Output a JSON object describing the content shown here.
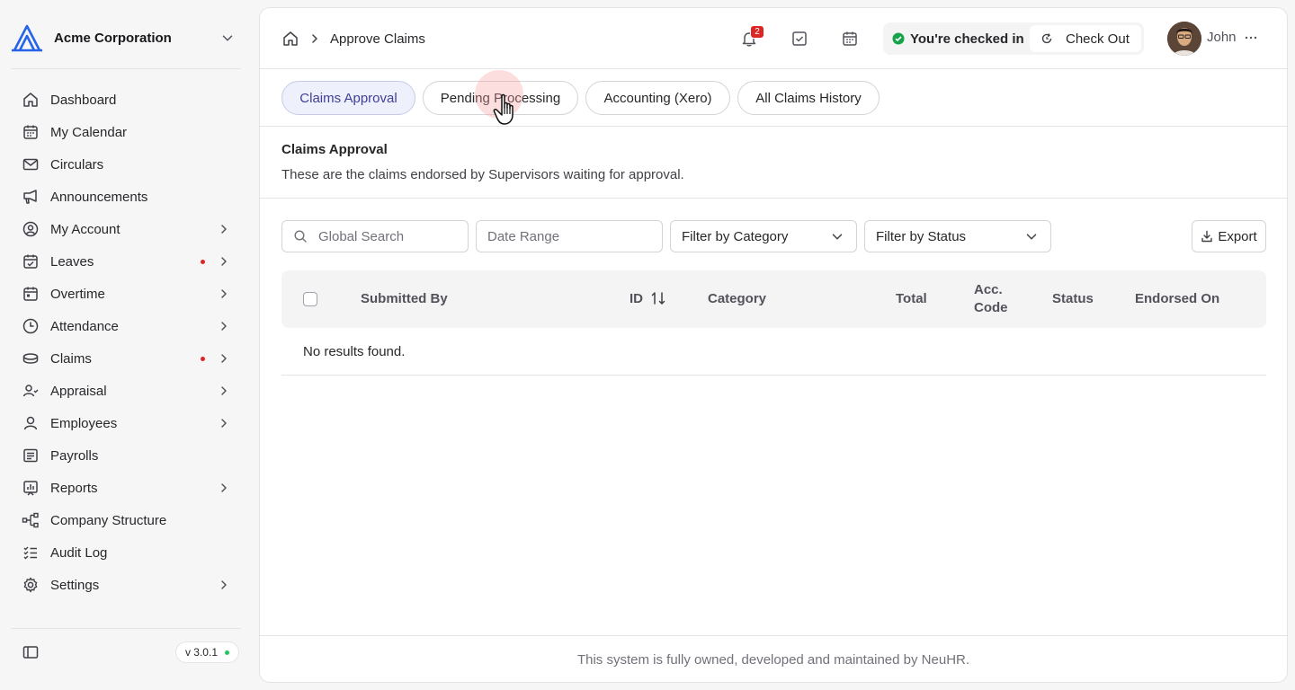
{
  "org": {
    "name": "Acme Corporation"
  },
  "sidebar": {
    "items": [
      {
        "label": "Dashboard",
        "icon": "home-icon",
        "arrow": false,
        "dot": false
      },
      {
        "label": "My Calendar",
        "icon": "calendar-icon",
        "arrow": false,
        "dot": false
      },
      {
        "label": "Circulars",
        "icon": "mail-icon",
        "arrow": false,
        "dot": false
      },
      {
        "label": "Announcements",
        "icon": "megaphone-icon",
        "arrow": false,
        "dot": false
      },
      {
        "label": "My Account",
        "icon": "user-circle-icon",
        "arrow": true,
        "dot": false
      },
      {
        "label": "Leaves",
        "icon": "calendar-check-icon",
        "arrow": true,
        "dot": true
      },
      {
        "label": "Overtime",
        "icon": "calendar-grid-icon",
        "arrow": true,
        "dot": false
      },
      {
        "label": "Attendance",
        "icon": "clock-icon",
        "arrow": true,
        "dot": false
      },
      {
        "label": "Claims",
        "icon": "coins-icon",
        "arrow": true,
        "dot": true
      },
      {
        "label": "Appraisal",
        "icon": "user-check-icon",
        "arrow": true,
        "dot": false
      },
      {
        "label": "Employees",
        "icon": "user-icon",
        "arrow": true,
        "dot": false
      },
      {
        "label": "Payrolls",
        "icon": "receipt-icon",
        "arrow": false,
        "dot": false
      },
      {
        "label": "Reports",
        "icon": "chart-icon",
        "arrow": true,
        "dot": false
      },
      {
        "label": "Company Structure",
        "icon": "hierarchy-icon",
        "arrow": false,
        "dot": false
      },
      {
        "label": "Audit Log",
        "icon": "checklist-icon",
        "arrow": false,
        "dot": false
      },
      {
        "label": "Settings",
        "icon": "gear-icon",
        "arrow": true,
        "dot": false
      }
    ],
    "version": "v 3.0.1"
  },
  "header": {
    "breadcrumb_page": "Approve Claims",
    "notification_count": "2",
    "checkin_status": "You're checked in",
    "checkout_label": "Check Out",
    "user_name": "John"
  },
  "tabs": [
    {
      "label": "Claims Approval",
      "active": true
    },
    {
      "label": "Pending Processing",
      "active": false
    },
    {
      "label": "Accounting (Xero)",
      "active": false
    },
    {
      "label": "All Claims History",
      "active": false
    }
  ],
  "section": {
    "title": "Claims Approval",
    "description": "These are the claims endorsed by Supervisors waiting for approval."
  },
  "filters": {
    "search_placeholder": "Global Search",
    "date_placeholder": "Date Range",
    "category_label": "Filter by Category",
    "status_label": "Filter by Status",
    "export_label": "Export"
  },
  "table": {
    "columns": {
      "submitted_by": "Submitted By",
      "id": "ID",
      "category": "Category",
      "total": "Total",
      "acc_code_1": "Acc.",
      "acc_code_2": "Code",
      "status": "Status",
      "endorsed_on": "Endorsed On"
    },
    "empty_text": "No results found."
  },
  "footer": {
    "text": "This system is fully owned, developed and maintained by NeuHR."
  },
  "colors": {
    "accent": "#3f3f9a",
    "alert": "#dc2626",
    "success": "#16a34a"
  }
}
